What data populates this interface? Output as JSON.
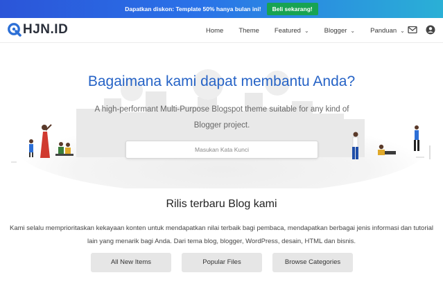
{
  "promo": {
    "text": "Dapatkan diskon: Template 50% hanya bulan ini!",
    "button_label": "Beli sekarang!"
  },
  "header": {
    "logo_text": "HJN.ID",
    "nav": [
      {
        "label": "Home"
      },
      {
        "label": "Theme"
      },
      {
        "label": "Featured"
      },
      {
        "label": "Blogger"
      },
      {
        "label": "Panduan"
      }
    ],
    "icons": [
      "mail-icon",
      "account-icon"
    ]
  },
  "hero": {
    "title": "Bagaimana kami dapat membantu Anda?",
    "subtitle": "A high-performant Multi-Purpose Blogspot theme suitable for any kind of Blogger project.",
    "search_placeholder": "Masukan Kata Kunci"
  },
  "section": {
    "title": "Rilis terbaru Blog kami",
    "description": "Kami selalu memprioritaskan kekayaan konten untuk mendapatkan nilai terbaik bagi pembaca, mendapatkan berbagai jenis informasi dan tutorial lain yang menarik bagi Anda. Dari tema blog, blogger, WordPress, desain, HTML dan bisnis."
  },
  "buttons": {
    "all_new": "All New Items",
    "popular": "Popular Files",
    "browse": "Browse Categories"
  },
  "colors": {
    "accent": "#2663c6",
    "promo_button": "#18a352",
    "button_bg": "#e6e6e6"
  }
}
